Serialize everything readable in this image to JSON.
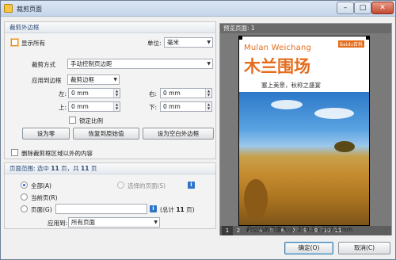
{
  "window": {
    "title": "裁剪页面",
    "minimize": "–",
    "maximize": "□",
    "close": "✕"
  },
  "margins": {
    "header": "裁剪外边框",
    "show_all_label": "显示所有",
    "units_label": "单位:",
    "units_value": "毫米",
    "crop_mode_label": "裁剪方式",
    "crop_mode_value": "手动控制页边距",
    "apply_to_label": "应用到边框",
    "apply_to_value": "裁剪边框",
    "left_label": "左:",
    "left_value": "0 mm",
    "right_label": "右:",
    "right_value": "0 mm",
    "top_label": "上:",
    "top_value": "0 mm",
    "bottom_label": "下:",
    "bottom_value": "0 mm",
    "lock_ratio_label": "锁定比例",
    "set_zero_button": "设为零",
    "restore_button": "恢复到原始值",
    "set_to_blank_button": "设为空白外边框",
    "delete_outside_label": "删除裁剪框区域以外的内容"
  },
  "page_range": {
    "header_prefix": "页面范围: 选中 ",
    "selected": "11",
    "header_mid": " 页，共 ",
    "total": "11",
    "header_suffix": " 页",
    "all_label": "全部(A)",
    "selected_pages_label": "选择的页面(S)",
    "current_label": "当前页(R)",
    "pages_label": "页面(G)",
    "pages_input_value": "",
    "count_prefix": "(总计 ",
    "count_value": "11",
    "count_suffix": " 页)",
    "apply_label": "应用到:",
    "apply_value": "所有页面"
  },
  "preview": {
    "header": "预览页面: 1",
    "brand": "Baidu百科",
    "title_en": "Mulan Weichang",
    "title_zh": "木兰围场",
    "subtitle": "塞上美景，秋称之盛宴",
    "pages": [
      "1",
      "2",
      "3",
      "4",
      "5",
      "6",
      "7",
      "8",
      "9",
      "10",
      "11"
    ],
    "active_page": "1",
    "paper_size": "裁切后的页面大小: 210.3 x 297.4 mm"
  },
  "footer": {
    "ok_button": "确定(O)",
    "cancel_button": "取消(C)"
  },
  "colors": {
    "accent_orange": "#e46c1c",
    "selected_blue": "#2a62c9"
  },
  "icons": {
    "app": "crop-dialog-icon",
    "info": "info-icon"
  }
}
